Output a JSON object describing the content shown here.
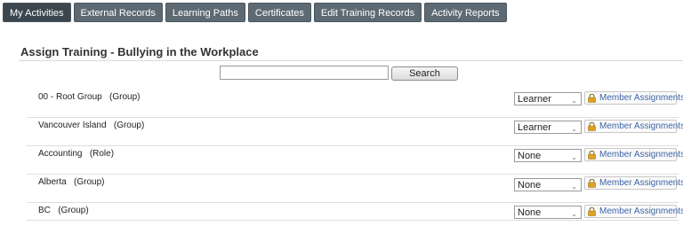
{
  "tabs": [
    {
      "label": "My Activities",
      "active": true
    },
    {
      "label": "External Records",
      "active": false
    },
    {
      "label": "Learning Paths",
      "active": false
    },
    {
      "label": "Certificates",
      "active": false
    },
    {
      "label": "Edit Training Records",
      "active": false
    },
    {
      "label": "Activity Reports",
      "active": false
    }
  ],
  "page": {
    "title": "Assign Training - Bullying in the Workplace"
  },
  "search": {
    "value": "",
    "placeholder": "",
    "button_label": "Search"
  },
  "rows": [
    {
      "label": "00 - Root Group   (Group)",
      "role": "Learner",
      "action": "Member Assignments"
    },
    {
      "label": "Vancouver Island   (Group)",
      "role": "Learner",
      "action": "Member Assignments"
    },
    {
      "label": "Accounting   (Role)",
      "role": "None",
      "action": "Member Assignments"
    },
    {
      "label": "Alberta   (Group)",
      "role": "None",
      "action": "Member Assignments"
    },
    {
      "label": "BC   (Group)",
      "role": "None",
      "action": "Member Assignments"
    }
  ],
  "icons": {
    "lock": "lock-icon",
    "dropdown": "chevron-down-icon"
  },
  "colors": {
    "tab_bg": "#5e6a73",
    "link": "#3a64a8",
    "lock": "#e0a020"
  }
}
